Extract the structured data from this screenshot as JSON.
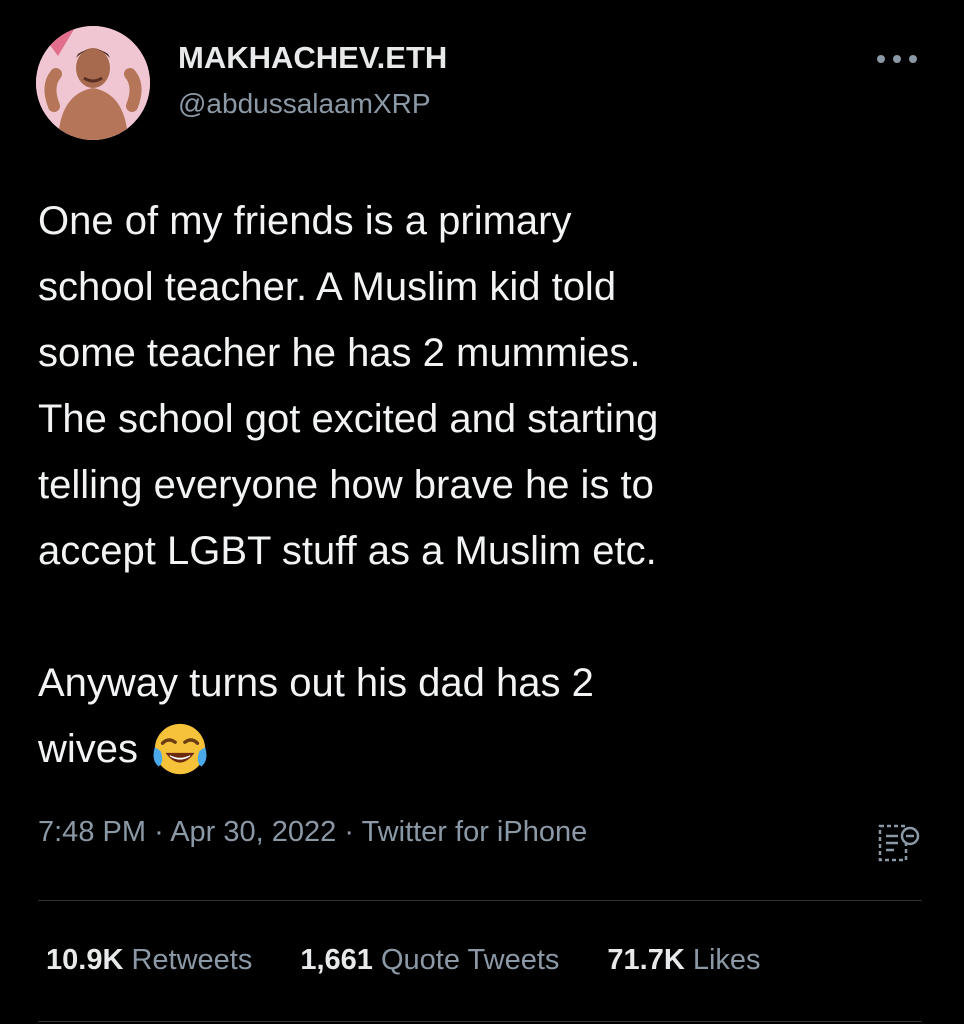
{
  "author": {
    "display_name": "MAKHACHEV.ETH",
    "handle": "@abdussalaamXRP",
    "avatar_icon": "fighter-avatar"
  },
  "tweet": {
    "paragraph1_lines": [
      "One of my friends is a primary",
      "school teacher. A Muslim kid told",
      "some teacher he has 2 mummies.",
      "The school got excited and starting",
      "telling everyone how brave he is to",
      "accept LGBT stuff as a Muslim etc."
    ],
    "paragraph2_lines": [
      "Anyway turns out his dad has 2",
      "wives"
    ],
    "emoji": "face-with-tears-of-joy"
  },
  "meta": {
    "time": "7:48 PM",
    "date": "Apr 30, 2022",
    "source": "Twitter for iPhone",
    "separator": "·"
  },
  "stats": {
    "retweets_count": "10.9K",
    "retweets_label": "Retweets",
    "quotes_count": "1,661",
    "quotes_label": "Quote Tweets",
    "likes_count": "71.7K",
    "likes_label": "Likes"
  },
  "colors": {
    "background": "#000000",
    "primary_text": "#e7e9ea",
    "secondary_text": "#8b98a5",
    "divider": "#2f3336"
  }
}
